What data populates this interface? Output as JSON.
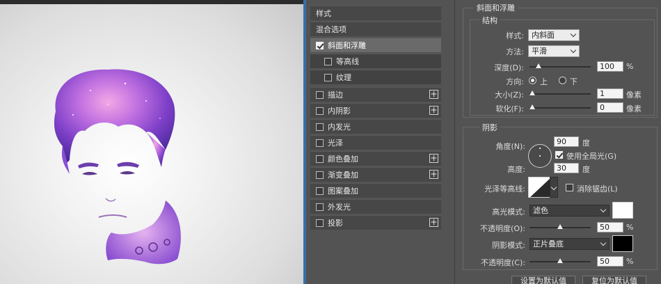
{
  "styles_list": {
    "header": "样式",
    "blend": "混合选项",
    "items": [
      {
        "label": "斜面和浮雕",
        "checked": true,
        "plus": false
      },
      {
        "label": "等高线",
        "checked": false,
        "plus": false
      },
      {
        "label": "纹理",
        "checked": false,
        "plus": false
      },
      {
        "label": "描边",
        "checked": false,
        "plus": true
      },
      {
        "label": "内阴影",
        "checked": false,
        "plus": true
      },
      {
        "label": "内发光",
        "checked": false,
        "plus": false
      },
      {
        "label": "光泽",
        "checked": false,
        "plus": false
      },
      {
        "label": "颜色叠加",
        "checked": false,
        "plus": true
      },
      {
        "label": "渐变叠加",
        "checked": false,
        "plus": true
      },
      {
        "label": "图案叠加",
        "checked": false,
        "plus": false
      },
      {
        "label": "外发光",
        "checked": false,
        "plus": false
      },
      {
        "label": "投影",
        "checked": false,
        "plus": true
      }
    ]
  },
  "bevel": {
    "section_title": "斜面和浮雕",
    "structure_title": "结构",
    "style_label": "样式:",
    "style_value": "内斜面",
    "technique_label": "方法:",
    "technique_value": "平滑",
    "depth_label": "深度(D):",
    "depth_value": "100",
    "depth_unit": "%",
    "depth_fraction": 0.1,
    "direction_label": "方向:",
    "direction_up": "上",
    "direction_down": "下",
    "size_label": "大小(Z):",
    "size_value": "1",
    "size_unit": "像素",
    "soften_label": "软化(F):",
    "soften_value": "0",
    "soften_unit": "像素"
  },
  "shading": {
    "title": "阴影",
    "angle_label": "角度(N):",
    "angle_value": "90",
    "angle_unit": "度",
    "global_light_label": "使用全局光(G)",
    "altitude_label": "高度:",
    "altitude_value": "30",
    "altitude_unit": "度",
    "gloss_label": "光泽等高线:",
    "anti_alias_label": "消除锯齿(L)",
    "highlight_label": "高光模式:",
    "highlight_value": "滤色",
    "highlight_color": "#ffffff",
    "opacity1_label": "不透明度(O):",
    "opacity1_value": "50",
    "shadow_label": "阴影模式:",
    "shadow_value": "正片叠底",
    "shadow_color": "#000000",
    "opacity2_label": "不透明度(C):",
    "opacity2_value": "50",
    "percent": "%"
  },
  "buttons": {
    "set_default": "设置为默认值",
    "reset_default": "复位为默认值"
  }
}
